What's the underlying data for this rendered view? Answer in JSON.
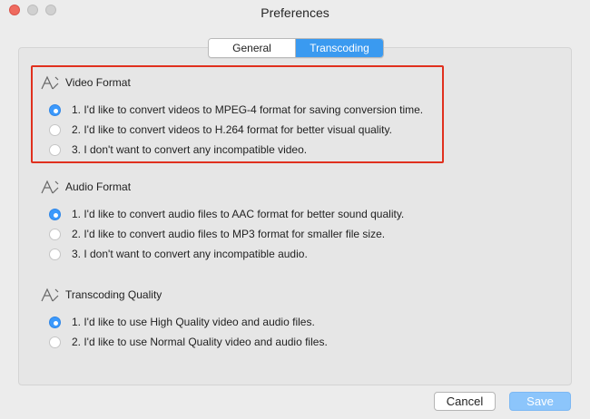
{
  "window": {
    "title": "Preferences"
  },
  "tabs": [
    {
      "label": "General",
      "selected": false
    },
    {
      "label": "Transcoding",
      "selected": true
    }
  ],
  "sections": [
    {
      "title": "Video Format",
      "icon": "pencil-ruler-icon",
      "options": [
        {
          "label": "1. I'd like to convert videos to MPEG-4 format for saving conversion time.",
          "selected": true
        },
        {
          "label": "2. I'd like to convert videos to H.264 format for better visual quality.",
          "selected": false
        },
        {
          "label": "3. I don't want to convert any incompatible video.",
          "selected": false
        }
      ]
    },
    {
      "title": "Audio Format",
      "icon": "pencil-ruler-icon",
      "options": [
        {
          "label": "1. I'd like to convert audio files to AAC format for better sound quality.",
          "selected": true
        },
        {
          "label": "2. I'd like to convert audio files to MP3 format for smaller file size.",
          "selected": false
        },
        {
          "label": "3. I don't want to convert any incompatible audio.",
          "selected": false
        }
      ]
    },
    {
      "title": "Transcoding Quality",
      "icon": "pencil-ruler-icon",
      "options": [
        {
          "label": "1. I'd like to use High Quality video and audio files.",
          "selected": true
        },
        {
          "label": "2. I'd like to use Normal Quality video and audio files.",
          "selected": false
        }
      ]
    }
  ],
  "buttons": {
    "cancel": "Cancel",
    "save": "Save"
  },
  "colors": {
    "accent": "#3a9af0",
    "highlight": "#e0301e",
    "save_disabled": "#8cc5fb"
  }
}
